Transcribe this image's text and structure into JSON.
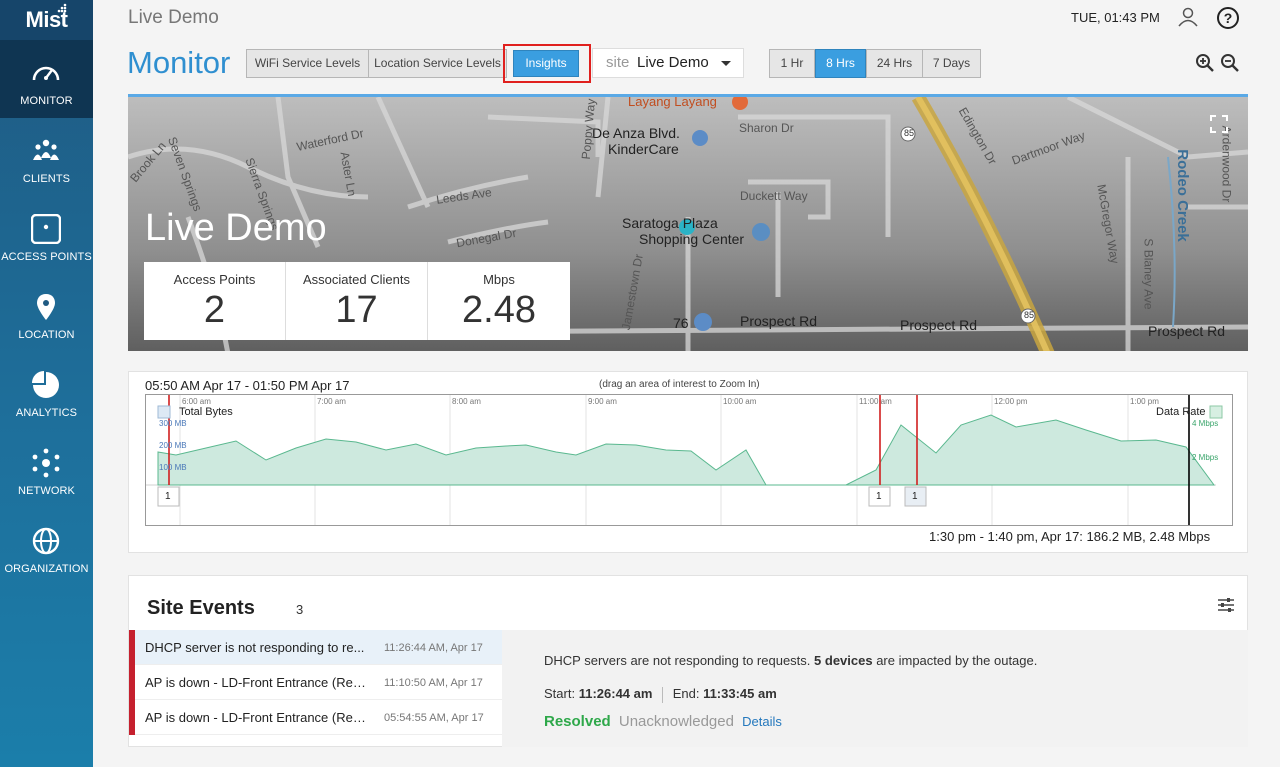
{
  "app": {
    "logo": "Mist"
  },
  "sidebar": {
    "items": [
      {
        "label": "MONITOR",
        "icon": "gauge-icon"
      },
      {
        "label": "CLIENTS",
        "icon": "users-icon"
      },
      {
        "label": "ACCESS POINTS",
        "icon": "access-point-icon"
      },
      {
        "label": "LOCATION",
        "icon": "map-pin-icon"
      },
      {
        "label": "ANALYTICS",
        "icon": "pie-chart-icon"
      },
      {
        "label": "NETWORK",
        "icon": "network-icon"
      },
      {
        "label": "ORGANIZATION",
        "icon": "globe-icon"
      }
    ]
  },
  "header": {
    "title": "Live Demo",
    "time": "TUE, 01:43 PM"
  },
  "monitor": {
    "title": "Monitor",
    "tabs": [
      "WiFi Service Levels",
      "Location Service Levels",
      "Insights"
    ],
    "site_prefix": "site",
    "site_value": "Live Demo",
    "ranges": [
      "1 Hr",
      "8 Hrs",
      "24 Hrs",
      "7 Days"
    ]
  },
  "map": {
    "site_name": "Live Demo",
    "labels": [
      "Layang Layang",
      "De Anza Blvd.",
      "KinderCare",
      "Sharon Dr",
      "Waterford Dr",
      "Aster Ln",
      "Leeds Ave",
      "Donegal Dr",
      "Duckett Way",
      "Saratoga Plaza",
      "Shopping Center",
      "Jamestown Dr",
      "Prospect Rd",
      "Prospect Rd",
      "Prospect Rd",
      "Rodeo Creek",
      "Dartmoor Way",
      "Edington Dr",
      "McGregor Way",
      "S Blaney Ave",
      "Ardenwood Dr",
      "Poppy Way",
      "Seven Springs",
      "Sierra Springs",
      "Brook Ln",
      "85",
      "85",
      "76"
    ],
    "stats": [
      {
        "title": "Access Points",
        "value": "2"
      },
      {
        "title": "Associated Clients",
        "value": "17"
      },
      {
        "title": "Mbps",
        "value": "2.48"
      }
    ]
  },
  "timeline": {
    "range": "05:50 AM Apr 17 - 01:50 PM Apr 17",
    "hint": "(drag an area of interest to Zoom In)",
    "footer": "1:30 pm - 1:40 pm, Apr 17: 186.2 MB, 2.48 Mbps",
    "time_labels": [
      "6:00 am",
      "7:00 am",
      "8:00 am",
      "9:00 am",
      "10:00 am",
      "11:00 am",
      "12:00 pm",
      "1:00 pm"
    ],
    "left_axis": [
      "300 MB",
      "200 MB",
      "100 MB"
    ],
    "right_axis": [
      "4 Mbps",
      "2 Mbps"
    ],
    "legend_left": "Total Bytes",
    "legend_right": "Data Rate",
    "markers": [
      "1",
      "1",
      "1"
    ]
  },
  "events": {
    "title": "Site Events",
    "count": "3",
    "items": [
      {
        "text": "DHCP server is not responding to re...",
        "time": "11:26:44 AM, Apr 17"
      },
      {
        "text": "AP is down - LD-Front Entrance (Reb...",
        "time": "11:10:50 AM, Apr 17"
      },
      {
        "text": "AP is down - LD-Front Entrance (Reb...",
        "time": "05:54:55 AM, Apr 17"
      }
    ],
    "detail": {
      "msg_pre": "DHCP servers are not responding to requests.",
      "msg_bold": "5 devices",
      "msg_post": "are impacted by the outage.",
      "start_label": "Start:",
      "start_value": "11:26:44 am",
      "end_label": "End:",
      "end_value": "11:33:45 am",
      "status_resolved": "Resolved",
      "status_unack": "Unacknowledged",
      "details_link": "Details"
    }
  },
  "colors": {
    "accent": "#3a9ee0",
    "title_blue": "#2f8fd0",
    "event_red": "#c5202e",
    "resolved_green": "#2ea84a",
    "sidebar_dark": "#0f3552",
    "chart_fill": "#cde9de",
    "chart_line": "#5ab88f"
  }
}
